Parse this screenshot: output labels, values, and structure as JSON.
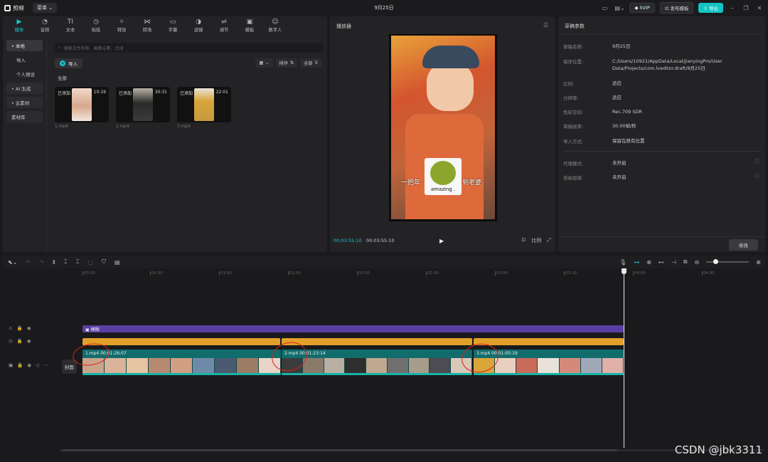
{
  "app": {
    "name": "剪映",
    "menu_label": "菜单",
    "project_title": "9月25日",
    "svip_label": "SVIP",
    "publish_label": "发布模板",
    "export_label": "导出"
  },
  "media": {
    "tabs": [
      {
        "label": "媒体",
        "icon": "media-icon"
      },
      {
        "label": "音频",
        "icon": "audio-icon"
      },
      {
        "label": "文本",
        "icon": "text-icon"
      },
      {
        "label": "贴纸",
        "icon": "sticker-icon"
      },
      {
        "label": "特效",
        "icon": "effects-icon"
      },
      {
        "label": "转场",
        "icon": "transition-icon"
      },
      {
        "label": "字幕",
        "icon": "subtitle-icon"
      },
      {
        "label": "滤镜",
        "icon": "filter-icon"
      },
      {
        "label": "调节",
        "icon": "adjust-icon"
      },
      {
        "label": "模板",
        "icon": "template-icon"
      },
      {
        "label": "数字人",
        "icon": "avatar-icon"
      }
    ],
    "side": {
      "local": "• 本地",
      "import": "导入",
      "personal": "个人预设",
      "ai": "• AI 生成",
      "cloud": "• 云素材",
      "library": "素材库"
    },
    "search_placeholder": "搜索文件名称、画面元素、台词",
    "import_label": "导入",
    "sort_label": "排序",
    "filter_label": "全部",
    "all_label": "全部",
    "items": [
      {
        "added": "已添加",
        "duration": "10:19",
        "name": "1.mp4"
      },
      {
        "added": "已添加",
        "duration": "30:31",
        "name": "2.mp4"
      },
      {
        "added": "已添加",
        "duration": "22:01",
        "name": "3.mp4"
      }
    ]
  },
  "player": {
    "title": "播放器",
    "caption_left": "一把年",
    "caption_right": "到老婆",
    "sticker_text": "amazing .",
    "current_time": "00:03:55:10",
    "total_time": "00:03:55:10",
    "ratio_label": "比例"
  },
  "draft": {
    "title": "草稿参数",
    "rows": [
      {
        "label": "草稿名称:",
        "value": "9月25日"
      },
      {
        "label": "保存位置:",
        "value": "C:/Users/10921/AppData/Local/JianyingPro/User Data/Projects/com.lveditor.draft/9月25日"
      },
      {
        "label": "比例:",
        "value": "适应"
      },
      {
        "label": "分辨率:",
        "value": "适应"
      },
      {
        "label": "色彩空间:",
        "value": "Rec.709 SDR"
      },
      {
        "label": "草稿帧率:",
        "value": "30.00帧/秒"
      },
      {
        "label": "导入方式:",
        "value": "保留在原有位置"
      },
      {
        "label": "代理模式:",
        "value": "未开启"
      },
      {
        "label": "自由层级:",
        "value": "未开启"
      }
    ],
    "modify_label": "修改"
  },
  "timeline": {
    "ticks": [
      "00:00",
      "00:30",
      "01:00",
      "01:30",
      "02:00",
      "02:30",
      "03:00",
      "03:30",
      "04:00",
      "04:30"
    ],
    "fx_label": "模糊",
    "cover_label": "封面",
    "clips": [
      {
        "label": "1.mp4  00:01:26:07"
      },
      {
        "label": "2.mp4  00:01:23:14"
      },
      {
        "label": "3.mp4  00:01:05:19"
      }
    ]
  },
  "watermark": "CSDN @jbk3311",
  "colors": {
    "accent": "#19c8d0",
    "clip": "#127a78",
    "fx": "#5a3fa3",
    "sticker": "#e0a02a",
    "annotation": "#e0221a"
  }
}
